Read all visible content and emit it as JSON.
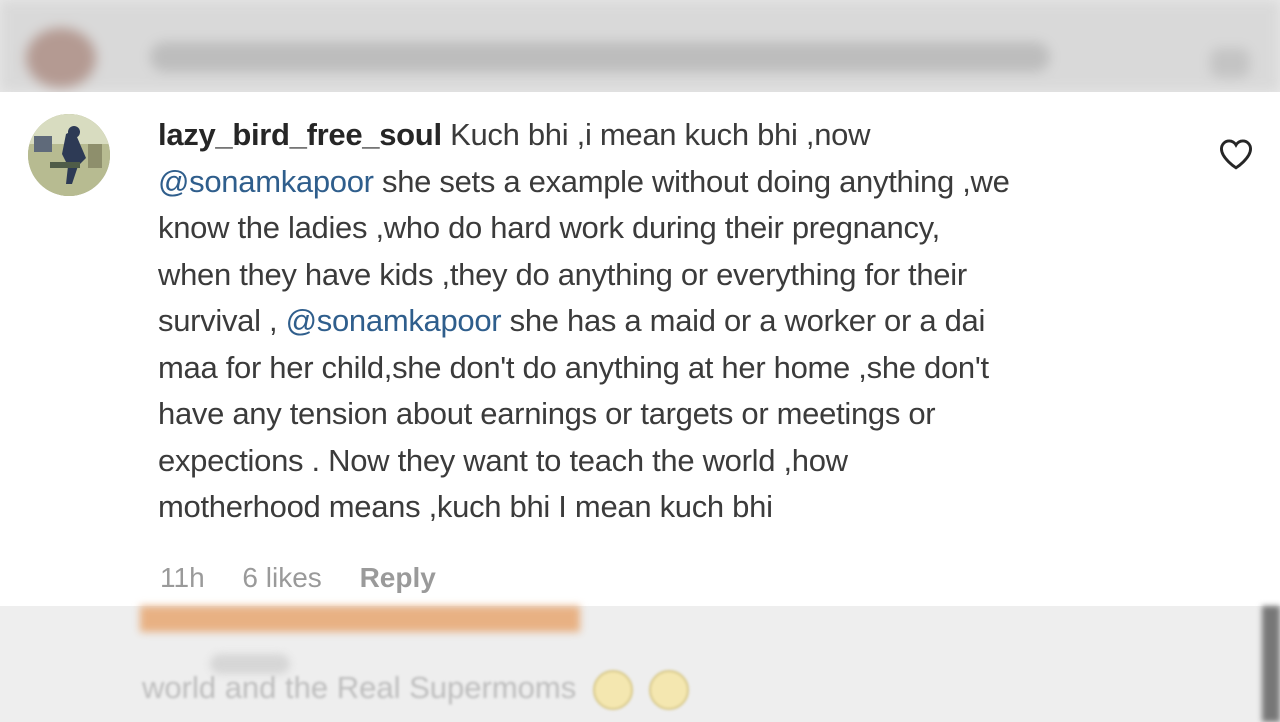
{
  "comment": {
    "username": "lazy_bird_free_soul",
    "lines": [
      [
        {
          "t": "Kuch bhi ,i mean kuch bhi ,now"
        }
      ],
      [
        {
          "t": "@sonamkapoor",
          "mention": true
        },
        {
          "t": " she sets a example without doing anything ,we"
        }
      ],
      [
        {
          "t": "know the ladies ,who do hard work during their pregnancy,"
        }
      ],
      [
        {
          "t": "when they have kids ,they do anything or everything for their"
        }
      ],
      [
        {
          "t": "survival , "
        },
        {
          "t": "@sonamkapoor",
          "mention": true
        },
        {
          "t": " she has a maid or a worker or a dai"
        }
      ],
      [
        {
          "t": "maa for her child,she don't do anything at her home ,she don't"
        }
      ],
      [
        {
          "t": "have any tension about earnings or targets or meetings or"
        }
      ],
      [
        {
          "t": "expections . Now they want to teach the world ,how"
        }
      ],
      [
        {
          "t": "motherhood means ,kuch bhi I mean kuch bhi"
        }
      ]
    ],
    "time": "11h",
    "likes": "6 likes",
    "reply_label": "Reply"
  },
  "blurred_next_comment": {
    "text": "world and the Real Supermoms"
  },
  "icons": {
    "like": "heart-outline-icon",
    "avatar": "profile-avatar"
  },
  "colors": {
    "mention": "#2f5e8c",
    "text": "#3b3b3b",
    "meta": "#9a9a9a"
  }
}
